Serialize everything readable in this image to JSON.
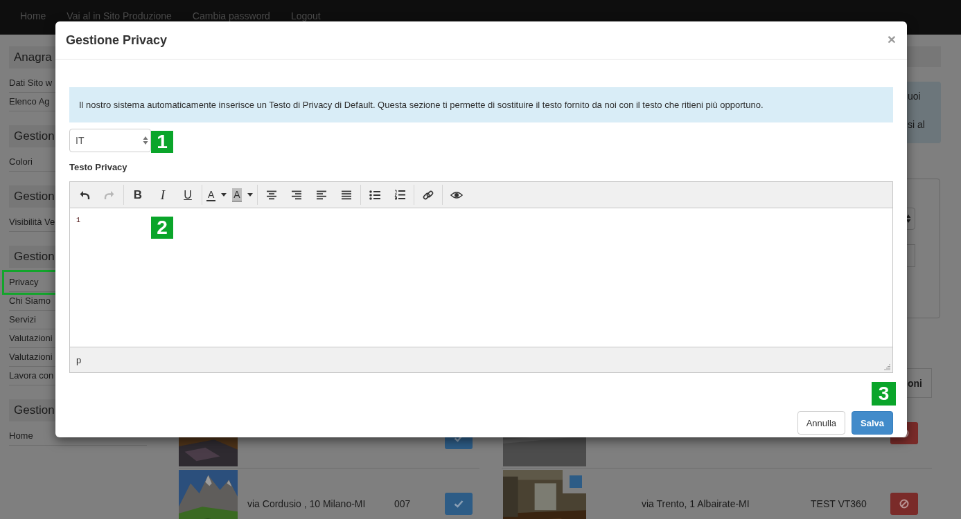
{
  "navbar": {
    "links": [
      "Home",
      "Vai al in Sito Produzione",
      "Cambia password",
      "Logout"
    ]
  },
  "sidebar": {
    "sections": [
      {
        "title": "Anagra",
        "items": [
          {
            "label": "Dati Sito w",
            "highlighted": false
          },
          {
            "label": "Elenco Ag",
            "highlighted": false
          }
        ]
      },
      {
        "title": "Gestion",
        "items": [
          {
            "label": "Colori",
            "highlighted": false
          }
        ]
      },
      {
        "title": "Gestion",
        "items": [
          {
            "label": "Visibilità Ve",
            "highlighted": false
          }
        ]
      },
      {
        "title": "Gestion",
        "items": [
          {
            "label": "Privacy",
            "highlighted": true
          },
          {
            "label": "Chi Siamo",
            "highlighted": false
          },
          {
            "label": "Servizi",
            "highlighted": false
          },
          {
            "label": "Valutazioni",
            "highlighted": false
          },
          {
            "label": "Valutazioni",
            "highlighted": false
          },
          {
            "label": "Lavora con",
            "highlighted": false
          }
        ]
      },
      {
        "title": "Gestion",
        "items": [
          {
            "label": "Home",
            "highlighted": false
          }
        ]
      }
    ]
  },
  "background": {
    "notice_lines": [
      "uoi",
      "si al"
    ],
    "table_header": "oni",
    "left_rows": [
      {
        "kind": "confirm"
      },
      {
        "address": "via Cordusio , 10 Milano-MI",
        "code": "007",
        "kind": "confirm"
      }
    ],
    "right_rows": [
      {
        "kind": "block"
      },
      {
        "address": "via Trento, 1 Albairate-MI",
        "code": "TEST VT360",
        "kind": "block"
      }
    ]
  },
  "modal": {
    "title": "Gestione Privacy",
    "close": "×",
    "notice": "Il nostro sistema automaticamente inserisce un Testo di Privacy di Default. Questa sezione ti permette di sostituire il testo fornito da noi con il testo che ritieni più opportuno.",
    "language": {
      "value": "IT"
    },
    "field_label": "Testo Privacy",
    "toolbar": [
      [
        {
          "kind": "undo",
          "disabled": false
        },
        {
          "kind": "redo",
          "disabled": true
        }
      ],
      [
        {
          "kind": "bold",
          "label": "B",
          "disabled": false
        },
        {
          "kind": "italic",
          "label": "I",
          "disabled": false
        },
        {
          "kind": "underline",
          "label": "U",
          "disabled": false
        }
      ],
      [
        {
          "kind": "forecolor",
          "label": "A",
          "disabled": false
        },
        {
          "kind": "backcolor",
          "label": "A",
          "disabled": false
        }
      ],
      [
        {
          "kind": "aligncenter",
          "disabled": false
        },
        {
          "kind": "alignright",
          "disabled": false
        },
        {
          "kind": "alignleft",
          "disabled": false
        },
        {
          "kind": "justify",
          "disabled": false
        }
      ],
      [
        {
          "kind": "bullist",
          "disabled": false
        },
        {
          "kind": "numlist",
          "disabled": false
        }
      ],
      [
        {
          "kind": "link",
          "disabled": false
        }
      ],
      [
        {
          "kind": "preview",
          "disabled": false
        }
      ]
    ],
    "content": "1",
    "status_path": "p",
    "buttons": [
      {
        "label": "Annulla",
        "kind": "default"
      },
      {
        "label": "Salva",
        "kind": "primary"
      }
    ]
  },
  "annotations": [
    "1",
    "2",
    "3"
  ]
}
